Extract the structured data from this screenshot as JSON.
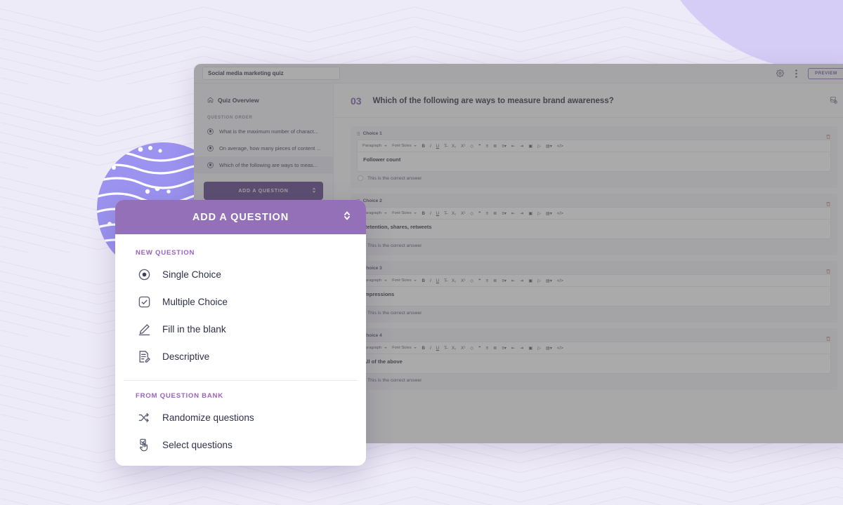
{
  "colors": {
    "panel_header": "#9370b8",
    "group_label": "#9a63c2",
    "sidebar_button": "#5d3f87",
    "question_number": "#7a5ca8",
    "correct_radio": "#7d3fa6",
    "background": "#eeebf8",
    "blob": "#d5cdf6",
    "circle": "#9b93ef"
  },
  "app": {
    "topbar": {
      "quiz_title": "Social media marketing quiz",
      "gear_icon": "gear-icon",
      "kebab_icon": "more-vertical-icon",
      "preview_label": "PREVIEW"
    },
    "sidebar": {
      "overview_label": "Quiz Overview",
      "overview_icon": "home-icon",
      "section_label": "QUESTION ORDER",
      "questions": [
        {
          "label": "What is the maximum number of charact...",
          "active": false
        },
        {
          "label": "On average, how many pieces of content ...",
          "active": false
        },
        {
          "label": "Which of the following are ways to meas...",
          "active": true
        }
      ],
      "add_question_label": "ADD A QUESTION"
    },
    "main": {
      "question_number": "03",
      "question_text": "Which of the following are ways to measure brand awareness?",
      "header_icon": "image-add-icon",
      "toolbar": {
        "paragraph_label": "Paragraph",
        "font_sizes_label": "Font Sizes",
        "icons": [
          "bold-icon",
          "italic-icon",
          "underline-icon",
          "strikethrough-icon",
          "subscript-icon",
          "superscript-icon",
          "clear-format-icon",
          "blockquote-icon",
          "align-left-icon",
          "align-center-icon",
          "align-menu-icon",
          "outdent-icon",
          "indent-icon",
          "insert-image-icon",
          "insert-video-icon",
          "table-icon",
          "code-icon"
        ]
      },
      "correct_answer_label": "This is the correct answer",
      "choices": [
        {
          "title": "Choice 1",
          "text": "Follower count",
          "correct": false
        },
        {
          "title": "Choice 2",
          "text": "Retention, shares, retweets",
          "correct": false
        },
        {
          "title": "Choice 3",
          "text": "Impressions",
          "correct": false
        },
        {
          "title": "Choice 4",
          "text": "All of the above",
          "correct": true
        }
      ]
    }
  },
  "dropdown": {
    "title": "ADD A QUESTION",
    "collapse_icon": "chevron-up-down-icon",
    "new_question_label": "NEW QUESTION",
    "new_question_items": [
      {
        "label": "Single Choice",
        "icon": "radio-button-icon"
      },
      {
        "label": "Multiple Choice",
        "icon": "checkbox-icon"
      },
      {
        "label": "Fill in the blank",
        "icon": "pencil-icon"
      },
      {
        "label": "Descriptive",
        "icon": "document-edit-icon"
      }
    ],
    "question_bank_label": "FROM QUESTION BANK",
    "question_bank_items": [
      {
        "label": "Randomize questions",
        "icon": "shuffle-icon"
      },
      {
        "label": "Select questions",
        "icon": "hand-select-icon"
      }
    ]
  }
}
